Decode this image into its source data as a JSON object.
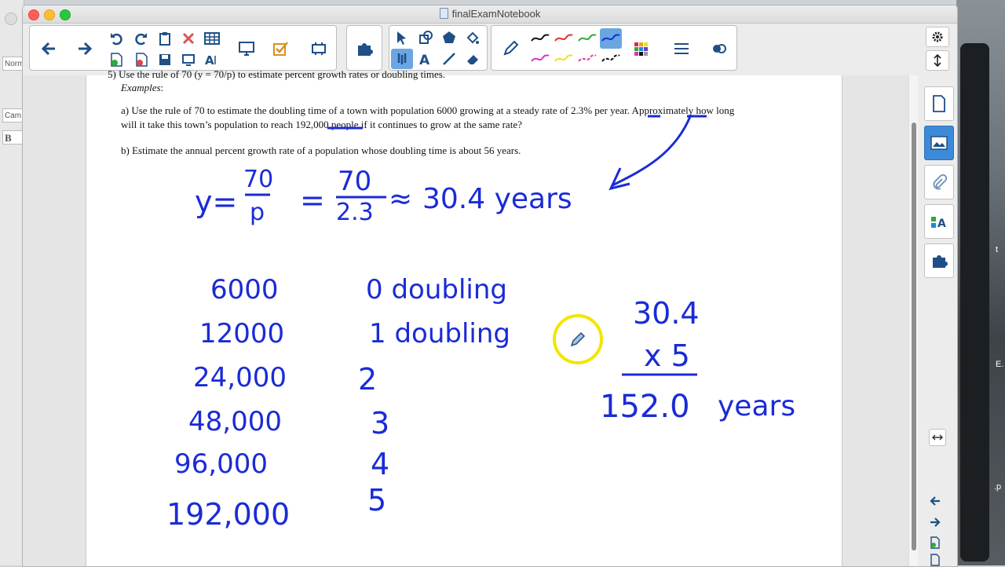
{
  "window": {
    "title": "finalExamNotebook"
  },
  "background_app": {
    "style_box": "Norm",
    "font_box": "Cam",
    "bold": "B"
  },
  "desktop": {
    "label_t": "t",
    "label_e": "E.",
    "label_p": ".p"
  },
  "question": {
    "heading": "5) Use the rule of 70 (y = 70/p) to estimate percent growth rates or doubling times.",
    "examples_label": "Examples",
    "examples_colon": ":",
    "part_a_line1": "a) Use the rule of 70 to estimate the doubling time of a town with population 6000 growing at a steady rate of 2.3% per year. Approximately how long",
    "part_a_line2": "will it take this town’s population to reach 192,000 people if it continues to grow at the same rate?",
    "part_b": "b) Estimate the annual percent growth rate of a population whose doubling time is about 56 years."
  },
  "handwriting": {
    "formula_y": "y=",
    "formula_num": "70",
    "formula_den": "p",
    "formula_eq": "=",
    "formula_num2": "70",
    "formula_den2": "2.3",
    "formula_approx": "≈",
    "formula_result": "30.4 years",
    "populations": [
      "6000",
      "12000",
      "24,000",
      "48,000",
      "96,000",
      "192,000"
    ],
    "doublings": [
      "0 doubling",
      "1 doubling",
      "2",
      "3",
      "4",
      "5"
    ],
    "calc_top": "30.4",
    "calc_mult": "x 5",
    "calc_result": "152.0",
    "calc_unit": "years"
  },
  "colors": {
    "ink": "#1a2bd6",
    "accent": "#3d8ad9",
    "cursor_ring": "#f2e600"
  }
}
